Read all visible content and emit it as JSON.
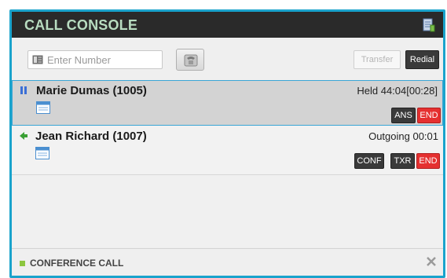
{
  "header": {
    "title": "CALL CONSOLE",
    "icon": "notepad-icon"
  },
  "toolbar": {
    "number_placeholder": "Enter Number",
    "number_value": "",
    "dial_icon": "phone-dial-icon",
    "transfer_label": "Transfer",
    "redial_label": "Redial"
  },
  "calls": [
    {
      "name": "Marie Dumas (1005)",
      "status_text": "Held 44:04[00:28]",
      "state_icon": "hold-icon",
      "buttons": [
        "ANS",
        "END"
      ]
    },
    {
      "name": "Jean Richard (1007)",
      "status_text": "Outgoing 00:01",
      "state_icon": "outgoing-arrow-icon",
      "buttons": [
        "CONF",
        "TXR",
        "END"
      ]
    }
  ],
  "footer": {
    "label": "CONFERENCE CALL",
    "close_icon": "close-icon"
  },
  "colors": {
    "frame": "#1aa3cc",
    "header": "#2a2a2a",
    "title": "#b8dcc0",
    "end_button": "#e53030",
    "status_green": "#8cc63f"
  }
}
